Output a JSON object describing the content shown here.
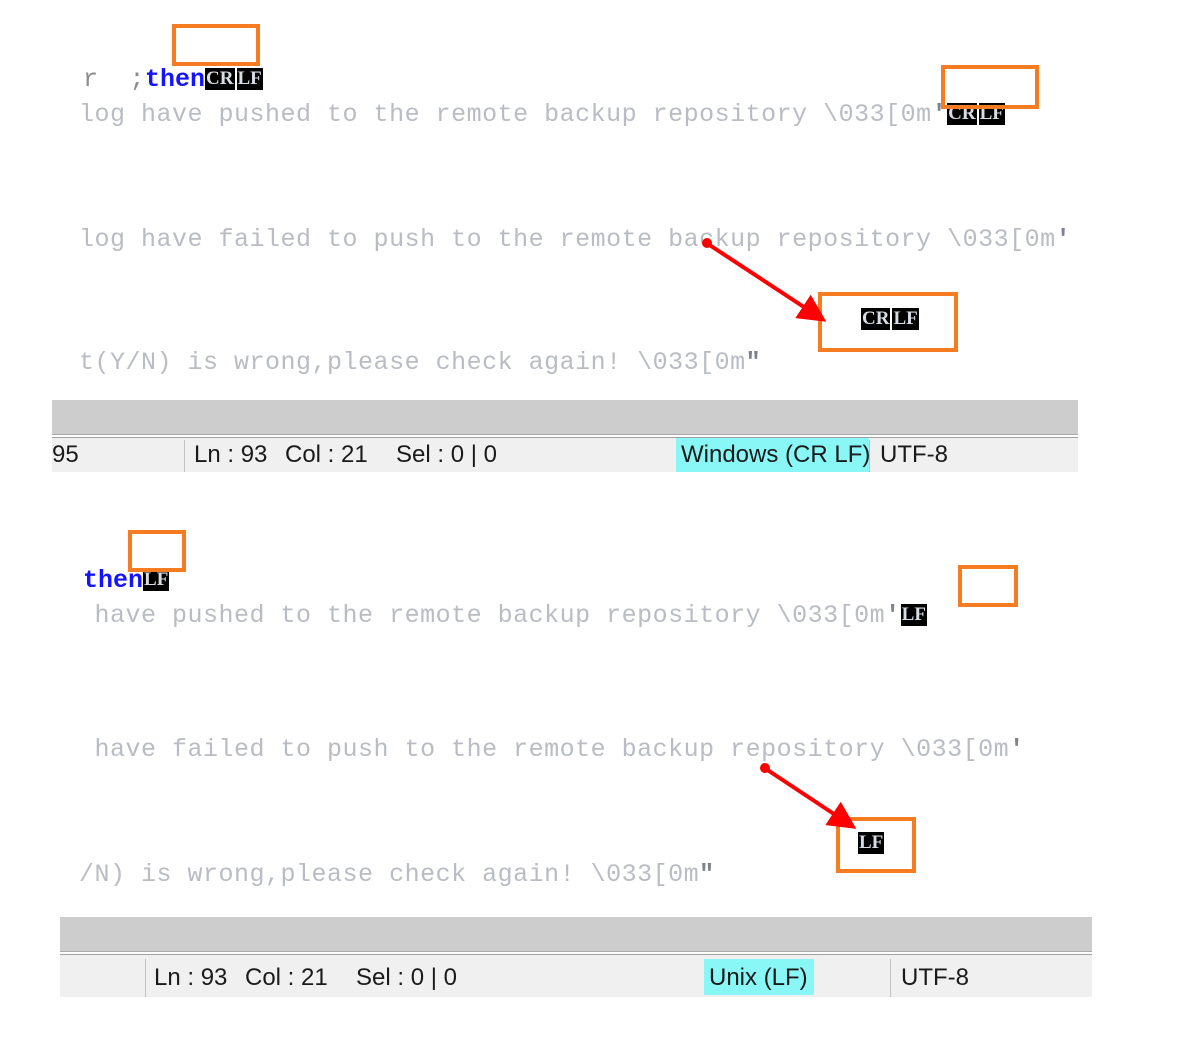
{
  "panels": [
    {
      "id": "crlf-panel",
      "eol_mode": "CRLF",
      "eol_chips": [
        "CR",
        "LF"
      ],
      "lines": [
        {
          "id": "line-then",
          "text_before": "r  ;",
          "keyword": "then",
          "text_after": "",
          "has_eol": true
        },
        {
          "id": "line-pushed",
          "text": "log have pushed to the remote backup repository \\033[0m",
          "trailing_quote": "'",
          "has_eol": true
        },
        {
          "id": "line-failed",
          "text": "log have failed to push to the remote backup repository \\033[0m",
          "trailing_quote": "'",
          "has_eol": false
        },
        {
          "id": "line-wrong",
          "text": "t(Y/N) is wrong,please check again! \\033[0m",
          "trailing_quote": "\"",
          "has_eol": false
        }
      ],
      "callout_eol": [
        "CR",
        "LF"
      ],
      "status": {
        "length": "95",
        "ln": "Ln : 93",
        "col": "Col : 21",
        "sel": "Sel : 0 | 0",
        "eol": "Windows (CR LF)",
        "encoding": "UTF-8"
      }
    },
    {
      "id": "lf-panel",
      "eol_mode": "LF",
      "eol_chips": [
        "LF"
      ],
      "lines": [
        {
          "id": "line-then",
          "text_before": "",
          "keyword": "then",
          "text_after": "",
          "has_eol": true
        },
        {
          "id": "line-pushed",
          "text": " have pushed to the remote backup repository \\033[0m",
          "trailing_quote": "'",
          "has_eol": true
        },
        {
          "id": "line-failed",
          "text": " have failed to push to the remote backup repository \\033[0m",
          "trailing_quote": "'",
          "has_eol": false
        },
        {
          "id": "line-wrong",
          "text": "/N) is wrong,please check again! \\033[0m",
          "trailing_quote": "\"",
          "has_eol": false
        }
      ],
      "callout_eol": [
        "LF"
      ],
      "status": {
        "length": "",
        "ln": "Ln : 93",
        "col": "Col : 21",
        "sel": "Sel : 0 | 0",
        "eol": "Unix (LF)",
        "encoding": "UTF-8"
      }
    }
  ],
  "colors": {
    "annotation_box": "#f57c20",
    "arrow": "#ff0000",
    "highlight": "#8af7f7",
    "keyword": "#1414ff",
    "eol_chip_bg": "#000000",
    "eol_chip_fg": "#d8dce4",
    "code_text": "#b9bcc4",
    "statusbar_top": "#cdcdcd",
    "statusbar_bottom": "#f0f0f0"
  }
}
